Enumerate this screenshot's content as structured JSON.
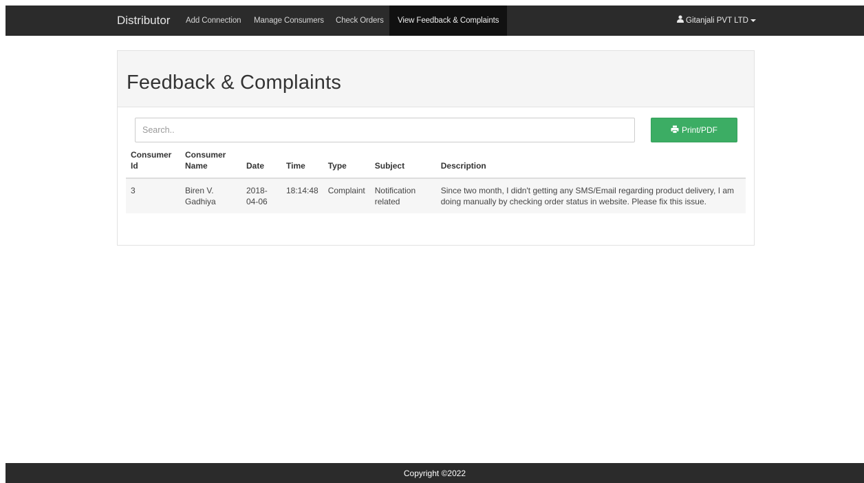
{
  "navbar": {
    "brand": "Distributor",
    "items": [
      {
        "label": "Add Connection"
      },
      {
        "label": "Manage Consumers"
      },
      {
        "label": "Check Orders"
      },
      {
        "label": "View Feedback & Complaints",
        "active": true
      }
    ],
    "user": {
      "label": "Gitanjali PVT LTD",
      "icon": "user-icon"
    }
  },
  "panel": {
    "title": "Feedback & Complaints",
    "search": {
      "placeholder": "Search..",
      "value": ""
    },
    "print_button": {
      "label": "Print/PDF",
      "icon": "printer-icon"
    }
  },
  "table": {
    "headers": {
      "consumer_id": "Consumer Id",
      "consumer_name": "Consumer Name",
      "date": "Date",
      "time": "Time",
      "type": "Type",
      "subject": "Subject",
      "description": "Description"
    },
    "rows": [
      {
        "consumer_id": "3",
        "consumer_name": "Biren V. Gadhiya",
        "date": "2018-04-06",
        "time": "18:14:48",
        "type": "Complaint",
        "subject": "Notification related",
        "description": "Since two month, I didn't getting any SMS/Email regarding product delivery, I am doing manually by checking order status in website. Please fix this issue."
      }
    ]
  },
  "footer": {
    "copyright": "Copyright ©2022"
  },
  "colors": {
    "navbar": "#2b2b2b",
    "active_tab": "#111111",
    "print_button": "#3cad64",
    "panel_heading": "#f5f5f5"
  }
}
